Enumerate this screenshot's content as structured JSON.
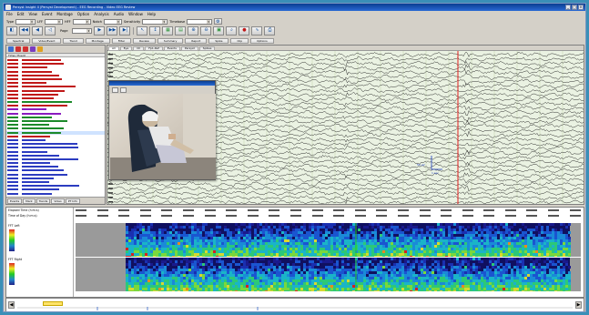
{
  "window": {
    "title": "Persyst Insight II (Persyst Development) - EEG Recording - Video EEG Review",
    "buttons": [
      "_",
      "□",
      "×"
    ]
  },
  "menu": [
    "File",
    "Edit",
    "View",
    "Event",
    "Montage",
    "Option",
    "Analysis",
    "Audio",
    "Window",
    "Help"
  ],
  "toolbar1": {
    "type_label": "Type",
    "lff_label": "LFF",
    "hff_label": "HFF",
    "notch_label": "Notch",
    "sensitivity_label": "Sensitivity",
    "timebase_label": "Timebase"
  },
  "toolbar2": {
    "page_label": "Page"
  },
  "toolbar3": {
    "tabs": [
      "Spectral",
      "Video/Event",
      "Trend",
      "Montage",
      "Filter",
      "Review",
      "Summary",
      "Report",
      "Spike",
      "Clip",
      "Options"
    ]
  },
  "leftpanel": {
    "header": "Time / Event",
    "tabs": [
      "Events",
      "Mark",
      "Trends",
      "Video",
      "PT Info"
    ]
  },
  "eeg": {
    "tabs": [
      "All",
      "Eye",
      "Ch",
      "Fp1-Ref",
      "Events",
      "Persyst",
      "Spikes"
    ],
    "scale_label": "50 µV",
    "time_scale_label": "1 sec"
  },
  "trends": {
    "row1_label": "Elapsed Time (h:m:s)",
    "row2_label": "Time of Day (h:m:s)",
    "panel1_label": "FFT Left",
    "panel2_label": "FFT Right",
    "freq_labels": [
      "25",
      "20",
      "15",
      "10",
      "5",
      "0"
    ]
  }
}
